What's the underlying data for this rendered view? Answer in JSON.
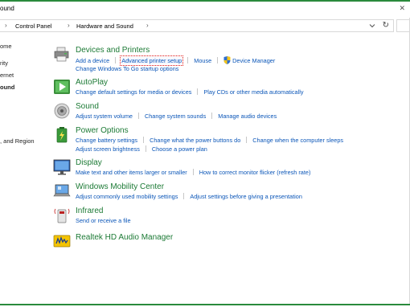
{
  "window": {
    "title": "ound"
  },
  "address": {
    "crumbs": [
      "Control Panel",
      "Hardware and Sound"
    ],
    "refresh_icon": "refresh-icon",
    "dropdown_icon": "chevron-down-icon"
  },
  "sidebar": {
    "items": [
      {
        "label": "ome"
      },
      {
        "label": "rity"
      },
      {
        "label": "ernet"
      },
      {
        "label": "ound"
      },
      {
        "label": ", and Region"
      }
    ]
  },
  "groups": [
    {
      "title": "Devices and Printers",
      "icon": "printer-icon",
      "lines": [
        [
          "Add a device",
          "Advanced printer setup",
          "Mouse",
          "Device Manager"
        ],
        [
          "Change Windows To Go startup options"
        ]
      ]
    },
    {
      "title": "AutoPlay",
      "icon": "autoplay-icon",
      "lines": [
        [
          "Change default settings for media or devices",
          "Play CDs or other media automatically"
        ]
      ]
    },
    {
      "title": "Sound",
      "icon": "speaker-icon",
      "lines": [
        [
          "Adjust system volume",
          "Change system sounds",
          "Manage audio devices"
        ]
      ]
    },
    {
      "title": "Power Options",
      "icon": "power-options-icon",
      "lines": [
        [
          "Change battery settings",
          "Change what the power buttons do",
          "Change when the computer sleeps"
        ],
        [
          "Adjust screen brightness",
          "Choose a power plan"
        ]
      ]
    },
    {
      "title": "Display",
      "icon": "monitor-icon",
      "lines": [
        [
          "Make text and other items larger or smaller",
          "How to correct monitor flicker (refresh rate)"
        ]
      ]
    },
    {
      "title": "Windows Mobility Center",
      "icon": "mobility-center-icon",
      "lines": [
        [
          "Adjust commonly used mobility settings",
          "Adjust settings before giving a presentation"
        ]
      ]
    },
    {
      "title": "Infrared",
      "icon": "infrared-icon",
      "lines": [
        [
          "Send or receive a file"
        ]
      ]
    },
    {
      "title": "Realtek HD Audio Manager",
      "icon": "realtek-audio-icon",
      "lines": []
    }
  ],
  "colors": {
    "link": "#0b56b8",
    "heading": "#1c7a35",
    "accent": "#2a8a3c",
    "focus": "#dd1111"
  }
}
